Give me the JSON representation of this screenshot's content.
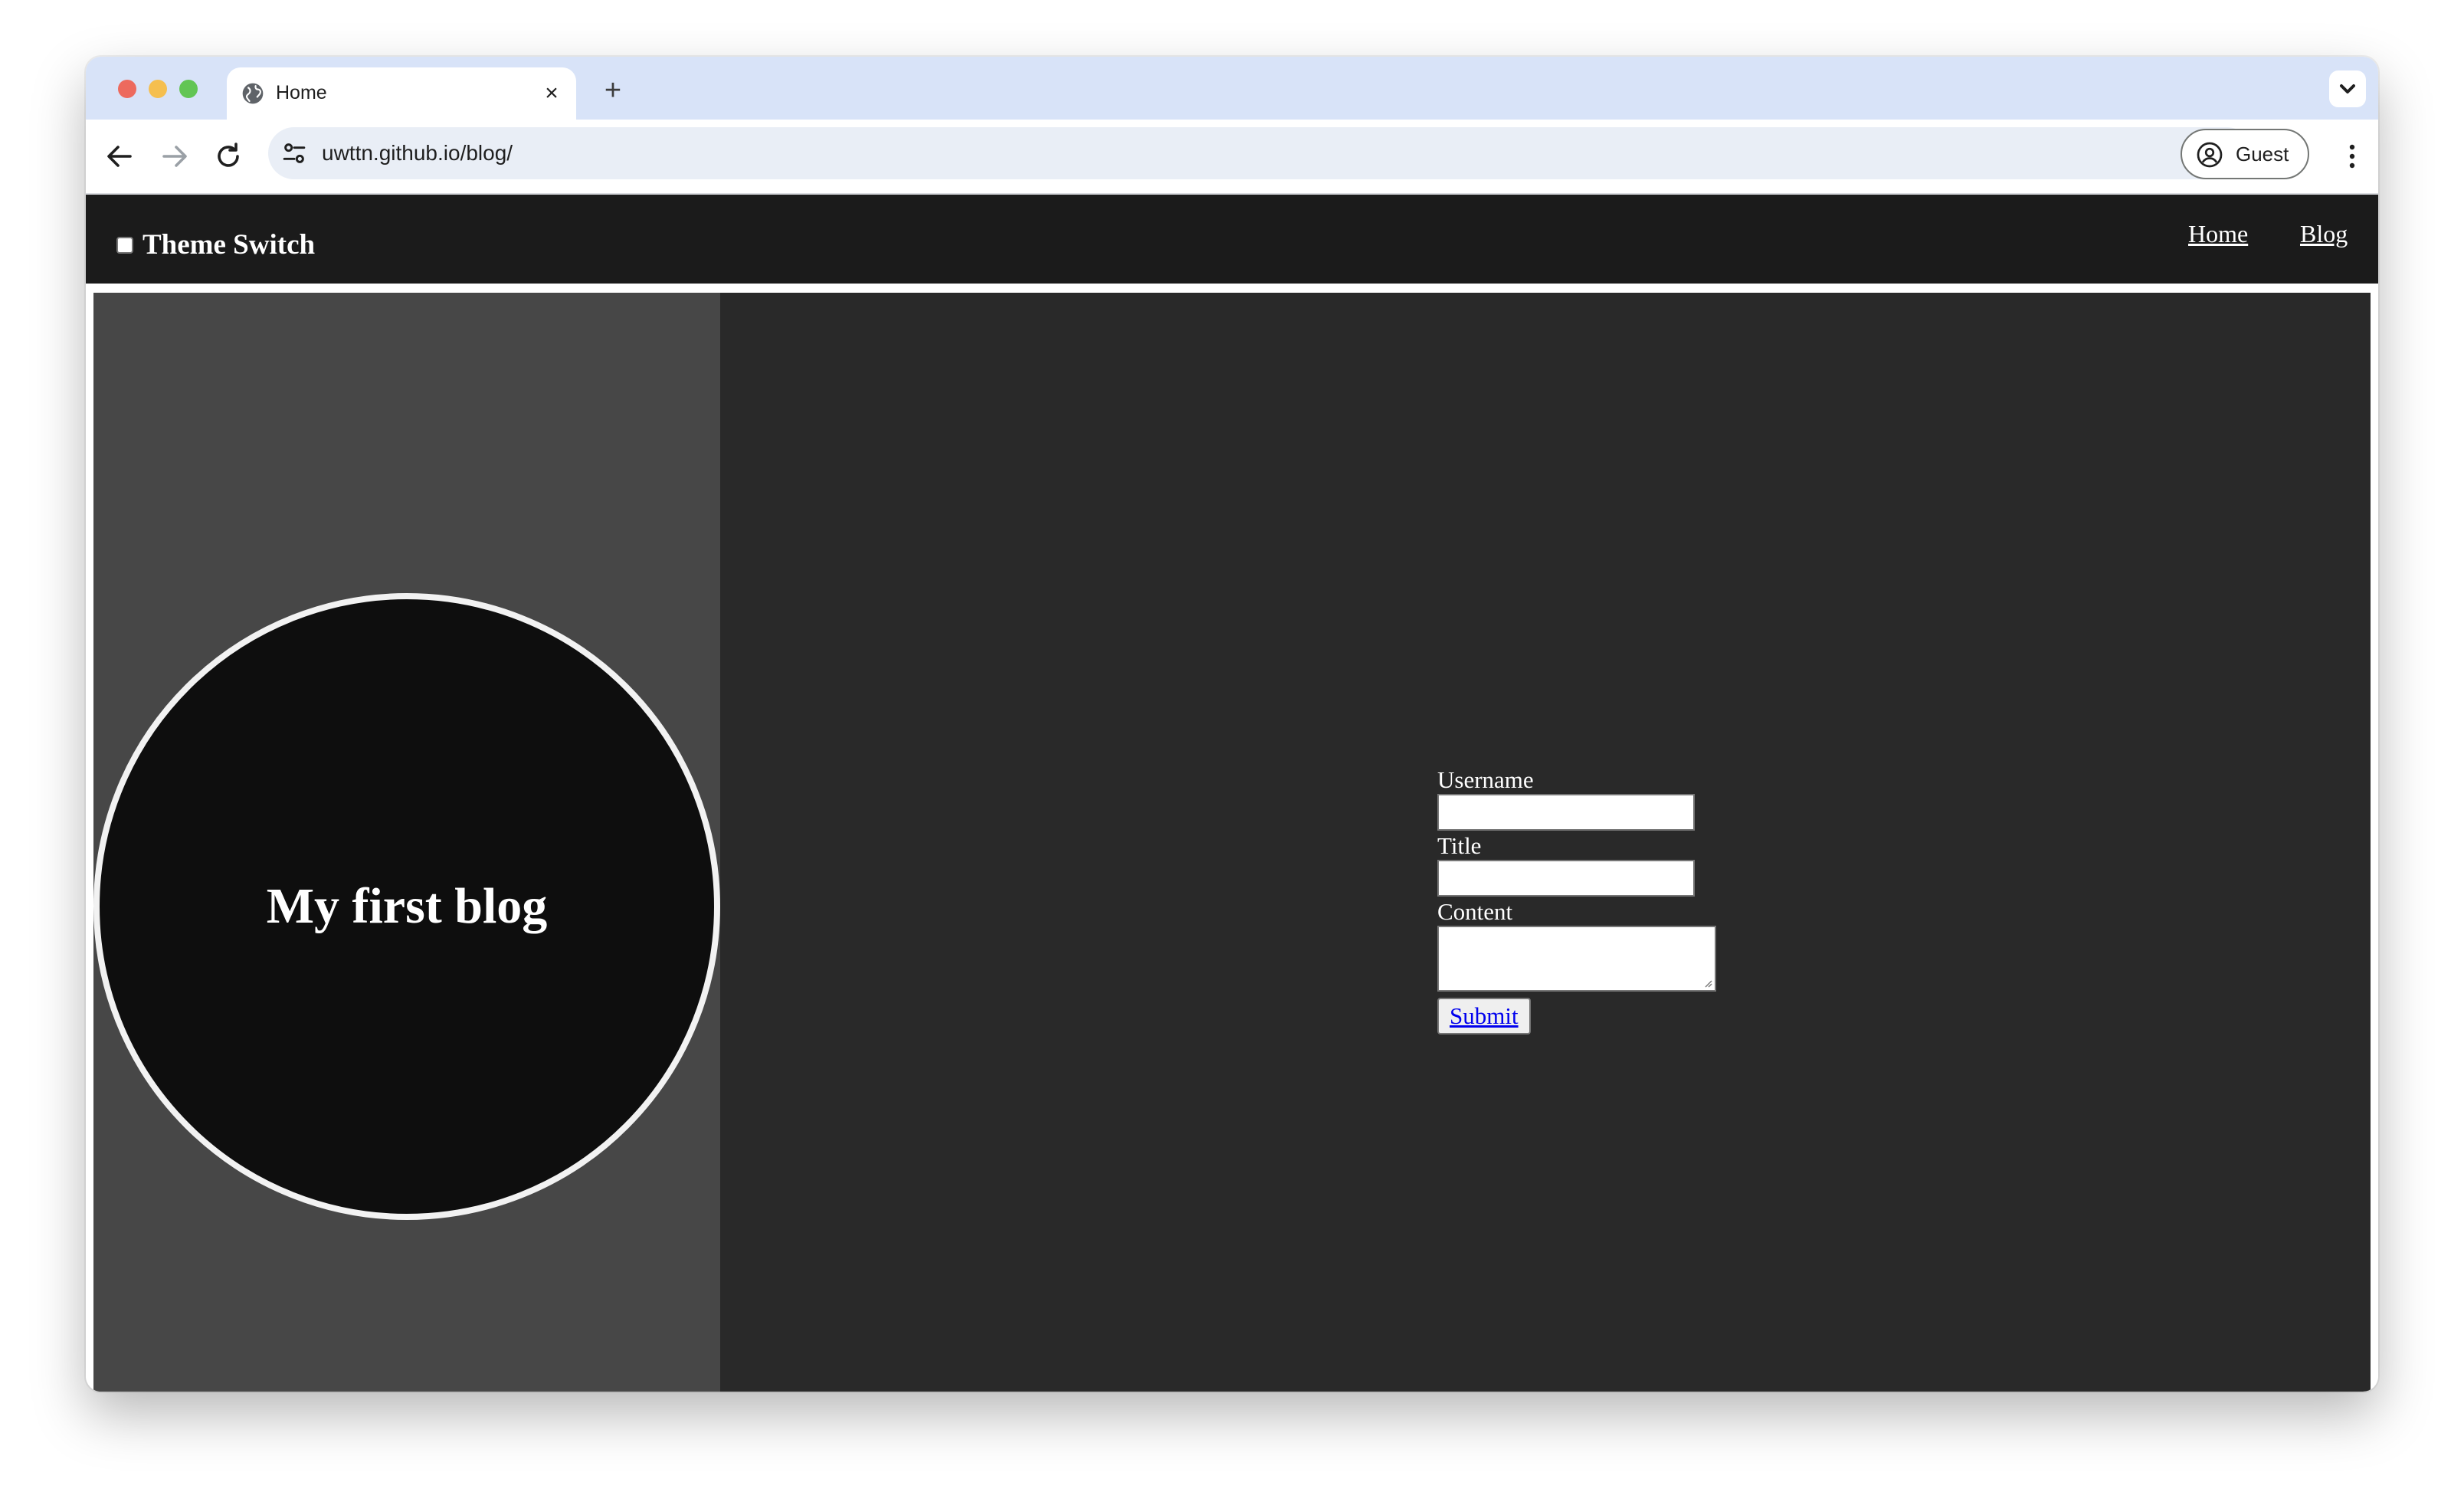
{
  "browser": {
    "tab": {
      "title": "Home",
      "close_symbol": "×"
    },
    "new_tab_symbol": "+",
    "address_bar": {
      "url": "uwttn.github.io/blog/"
    },
    "profile": {
      "label": "Guest"
    },
    "icons": {
      "favicon": "globe-icon",
      "back": "arrow-left-icon",
      "forward": "arrow-right-icon",
      "reload": "reload-icon",
      "site_info": "tune-icon",
      "profile": "account-circle-icon",
      "menu": "more-vertical-icon",
      "tab_search": "chevron-down-icon"
    }
  },
  "site": {
    "header": {
      "theme_switch_label": "Theme Switch",
      "theme_switch_checked": false,
      "nav": [
        {
          "label": "Home"
        },
        {
          "label": "Blog"
        }
      ]
    },
    "hero": {
      "title": "My first blog"
    },
    "form": {
      "username_label": "Username",
      "username_value": "",
      "title_label": "Title",
      "title_value": "",
      "content_label": "Content",
      "content_value": "",
      "submit_label": "Submit"
    }
  },
  "colors": {
    "header_bg": "#1b1b1b",
    "main_bg": "#292929",
    "left_panel_bg": "#474747",
    "circle_bg": "#0e0e0e",
    "tabstrip_bg": "#d8e3f8",
    "link_color": "#0000ee"
  }
}
